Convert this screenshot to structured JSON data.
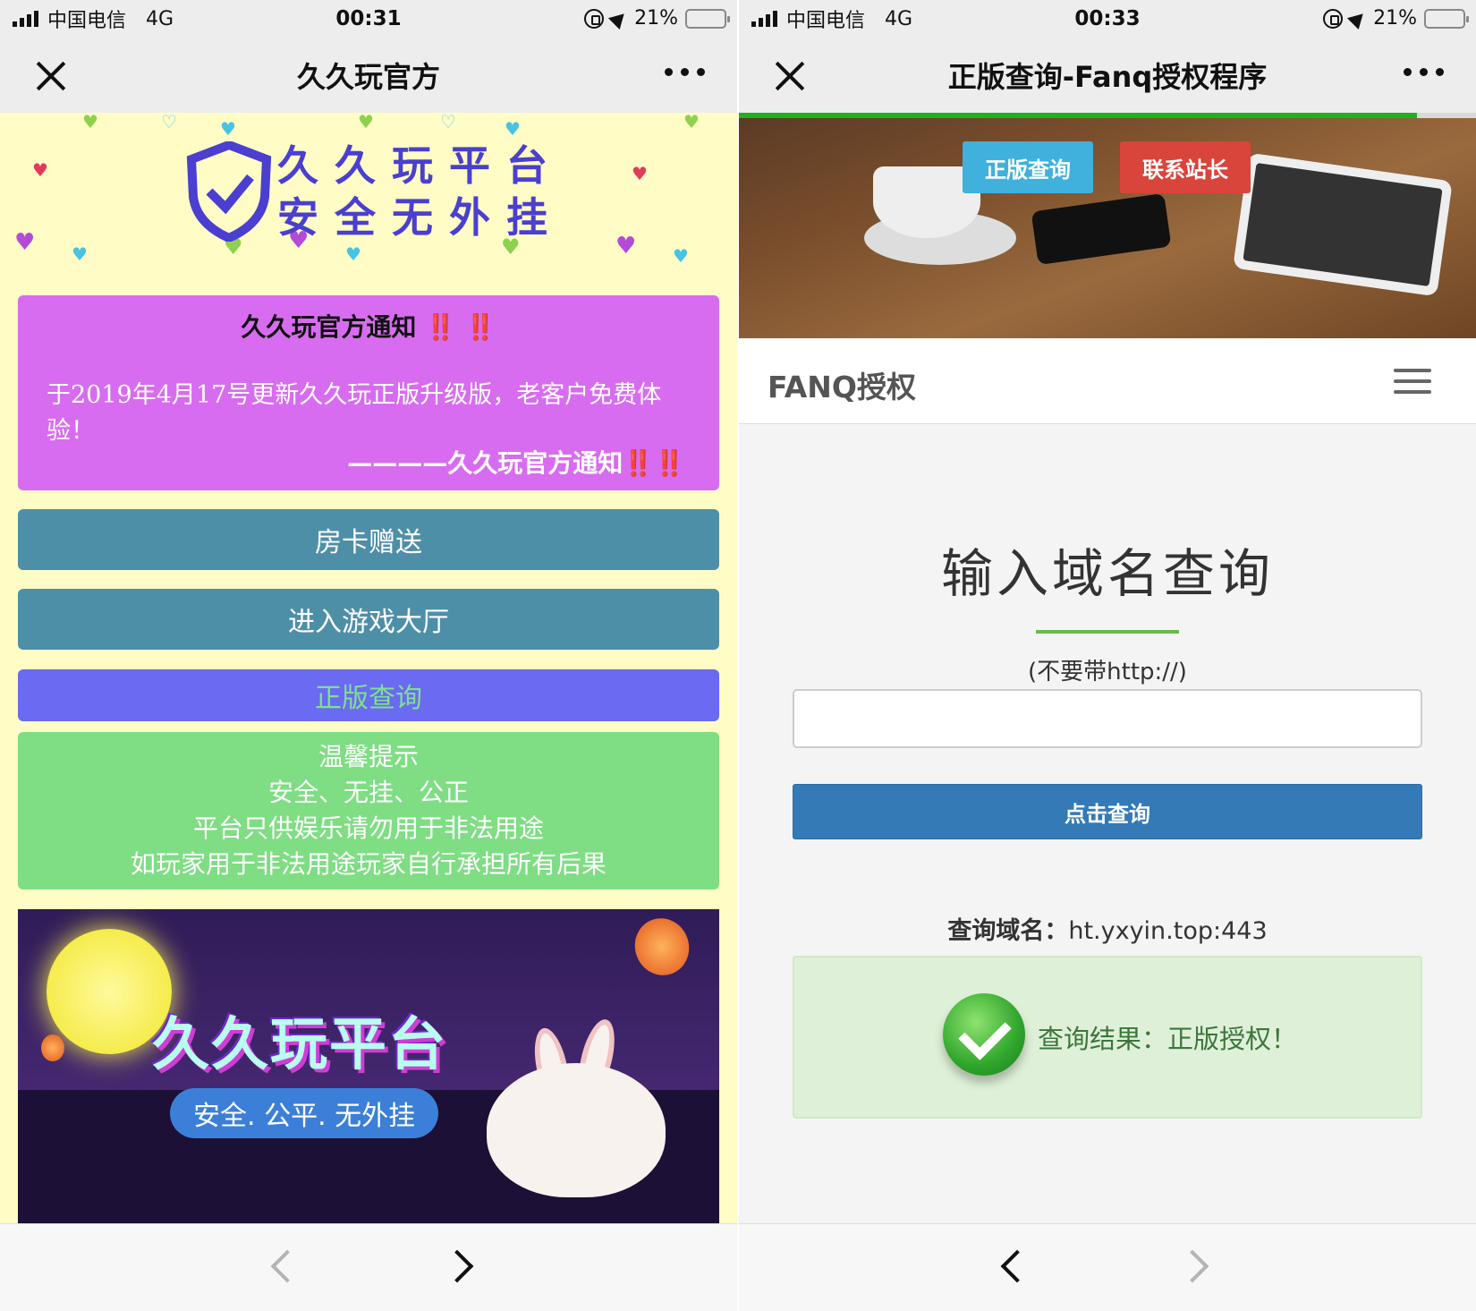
{
  "left": {
    "status": {
      "carrier": "中国电信",
      "network": "4G",
      "time": "00:31",
      "battery": "21%",
      "battery_level": 0.21
    },
    "nav": {
      "title": "久久玩官方"
    },
    "logo": {
      "line1": "久久玩平台",
      "line2": "安全无外挂"
    },
    "notice": {
      "title": "久久玩官方通知",
      "exclaim": "‼️ ‼️",
      "body": "于2019年4月17号更新久久玩正版升级版，老客户免费体验！",
      "signature": "————久久玩官方通知",
      "sign_exclaim": "‼️‼️"
    },
    "buttons": {
      "room_card": "房卡赠送",
      "enter_lobby": "进入游戏大厅",
      "verify": "正版查询"
    },
    "tips": [
      "温馨提示",
      "安全、无挂、公正",
      "平台只供娱乐请勿用于非法用途",
      "如玩家用于非法用途玩家自行承担所有后果"
    ],
    "banner": {
      "title": "久久玩平台",
      "slogan": "安全. 公平. 无外挂"
    },
    "colors": {
      "page_bg": "#fffcc6",
      "notice_bg": "#d86cf0",
      "button_bg": "#4e8fa8",
      "verify_bg": "#6a6af2",
      "tips_bg": "#7fdd84"
    }
  },
  "right": {
    "status": {
      "carrier": "中国电信",
      "network": "4G",
      "time": "00:33",
      "battery": "21%",
      "battery_level": 0.21
    },
    "nav": {
      "title": "正版查询-Fanq授权程序"
    },
    "page_load_progress": 0.92,
    "hero": {
      "btn_verify": "正版查询",
      "btn_contact": "联系站长"
    },
    "brand": "FANQ授权",
    "query": {
      "title": "输入域名查询",
      "hint": "(不要带http://)",
      "input_value": "",
      "button": "点击查询",
      "domain_label": "查询域名：",
      "domain_value": "ht.yxyin.top:443",
      "result": "查询结果：正版授权！"
    },
    "colors": {
      "primary": "#337ab7",
      "success_bg": "#dff0d8",
      "success_text": "#3c763d",
      "accent_line": "#6ab94a",
      "progress": "#1db31d"
    }
  }
}
